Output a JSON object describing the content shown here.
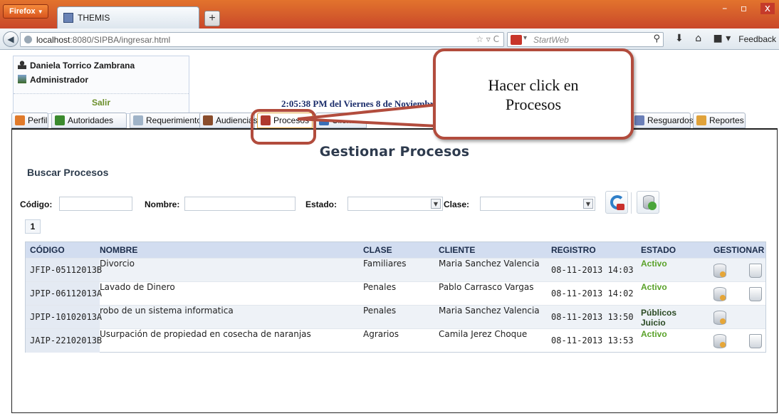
{
  "browser": {
    "menu_button": "Firefox",
    "tab_title": "THEMIS",
    "new_tab": "+",
    "url_host": "localhost",
    "url_path": ":8080/SIPBA/ingresar.html",
    "search_placeholder": "StartWeb",
    "feedback": "Feedback"
  },
  "user": {
    "name": "Daniela Torrico Zambrana",
    "role": "Administrador",
    "logout": "Salir"
  },
  "clock": "2:05:38 PM del Viernes 8 de Noviembre",
  "tabs": [
    {
      "label": "Perfil",
      "color": "#e07a2a"
    },
    {
      "label": "Autoridades",
      "color": "#3b8a2e"
    },
    {
      "label": "Requerimientos",
      "color": "#9fb3c8"
    },
    {
      "label": "Audiencias",
      "color": "#8a4d2c"
    },
    {
      "label": "Procesos",
      "color": "#b03a2e"
    },
    {
      "label": "Clientes",
      "color": "#3a6fb8"
    },
    {
      "label": "Resguardos",
      "color": "#6b7fb8"
    },
    {
      "label": "Reportes",
      "color": "#e0a23a"
    }
  ],
  "main": {
    "title": "Gestionar Procesos",
    "search_title": "Buscar Procesos",
    "filters": {
      "codigo_label": "Código:",
      "nombre_label": "Nombre:",
      "estado_label": "Estado:",
      "clase_label": "Clase:",
      "codigo_value": "",
      "nombre_value": "",
      "estado_value": "",
      "clase_value": ""
    },
    "page": "1"
  },
  "table": {
    "headers": [
      "CÓDIGO",
      "NOMBRE",
      "CLASE",
      "CLIENTE",
      "REGISTRO",
      "ESTADO",
      "GESTIONAR"
    ],
    "rows": [
      {
        "codigo": "JFIP-05112013B",
        "nombre": "Divorcio",
        "clase": "Familiares",
        "cliente": "Maria Sanchez Valencia",
        "registro": "08-11-2013 14:03",
        "estado": "Activo"
      },
      {
        "codigo": "JPIP-06112013A",
        "nombre": "Lavado de Dinero",
        "clase": "Penales",
        "cliente": "Pablo Carrasco Vargas",
        "registro": "08-11-2013 14:02",
        "estado": "Activo"
      },
      {
        "codigo": "JPIP-10102013A",
        "nombre": "robo de un sistema informatica",
        "clase": "Penales",
        "cliente": "Maria Sanchez Valencia",
        "registro": "08-11-2013 13:50",
        "estado_line1": "Públicos",
        "estado_line2": "Juicio"
      },
      {
        "codigo": "JAIP-22102013B",
        "nombre": "Usurpación de propiedad en cosecha de naranjas",
        "clase": "Agrarios",
        "cliente": "Camila Jerez Choque",
        "registro": "08-11-2013 13:53",
        "estado": "Activo"
      }
    ]
  },
  "callout": {
    "line1": "Hacer click en",
    "line2": "Procesos",
    "color": "#b24c3d"
  }
}
